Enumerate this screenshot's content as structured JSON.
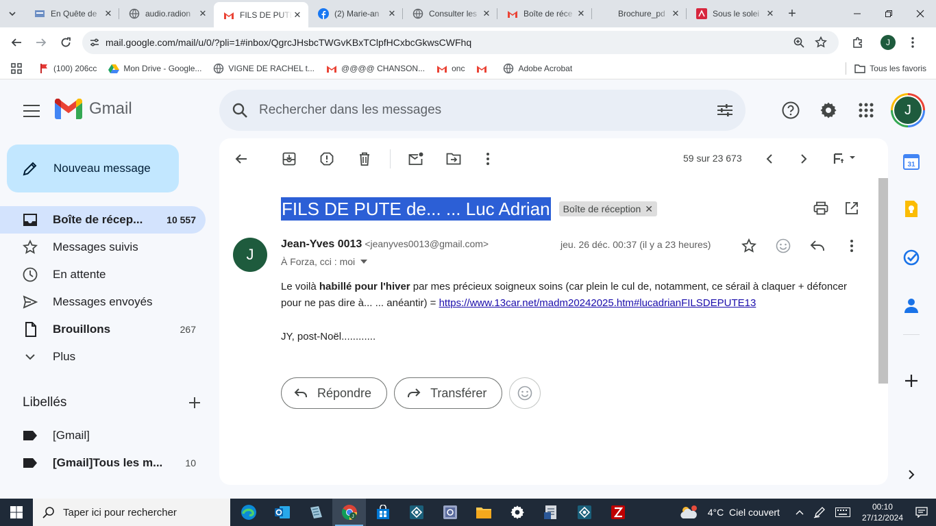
{
  "browser": {
    "tabs": [
      {
        "title": "En Quête de",
        "favicon": "page-icon",
        "active": false
      },
      {
        "title": "audio.radion",
        "favicon": "globe-icon",
        "active": false
      },
      {
        "title": "FILS DE PUTE",
        "favicon": "gmail-icon",
        "active": true
      },
      {
        "title": "(2) Marie-an",
        "favicon": "facebook-icon",
        "active": false
      },
      {
        "title": "Consulter les",
        "favicon": "globe-icon",
        "active": false
      },
      {
        "title": "Boîte de réce",
        "favicon": "gmail-icon",
        "active": false
      },
      {
        "title": "Brochure_pd",
        "favicon": "blank-icon",
        "active": false
      },
      {
        "title": "Sous le solei",
        "favicon": "pdf-icon",
        "active": false
      }
    ],
    "url": "mail.google.com/mail/u/0/?pli=1#inbox/QgrcJHsbcTWGvKBxTClpfHCxbcGkwsCWFhq",
    "profile_initial": "J",
    "bookmarks": [
      {
        "label": "(100) 206cc",
        "icon": "flag-icon"
      },
      {
        "label": "Mon Drive - Google...",
        "icon": "drive-icon"
      },
      {
        "label": "VIGNE DE RACHEL t...",
        "icon": "globe-icon"
      },
      {
        "label": "@@@@ CHANSON...",
        "icon": "gmail-icon"
      },
      {
        "label": "onc",
        "icon": "gmail-icon"
      },
      {
        "label": "",
        "icon": "gmail-icon"
      },
      {
        "label": "Adobe Acrobat",
        "icon": "globe-icon"
      }
    ],
    "all_bookmarks_label": "Tous les favoris"
  },
  "gmail": {
    "logo_text": "Gmail",
    "search_placeholder": "Rechercher dans les messages",
    "avatar_initial": "J",
    "compose_label": "Nouveau message",
    "nav": [
      {
        "label": "Boîte de récep...",
        "count": "10 557",
        "icon": "inbox-icon",
        "active": true,
        "bold": true
      },
      {
        "label": "Messages suivis",
        "count": "",
        "icon": "star-icon",
        "active": false,
        "bold": false
      },
      {
        "label": "En attente",
        "count": "",
        "icon": "clock-icon",
        "active": false,
        "bold": false
      },
      {
        "label": "Messages envoyés",
        "count": "",
        "icon": "send-icon",
        "active": false,
        "bold": false
      },
      {
        "label": "Brouillons",
        "count": "267",
        "icon": "draft-icon",
        "active": false,
        "bold": true
      },
      {
        "label": "Plus",
        "count": "",
        "icon": "chevron-down-icon",
        "active": false,
        "bold": false
      }
    ],
    "labels_heading": "Libellés",
    "labels": [
      {
        "label": "[Gmail]",
        "count": "",
        "bold": false
      },
      {
        "label": "[Gmail]Tous les m...",
        "count": "10",
        "bold": true
      }
    ],
    "message_counter": "59 sur 23 673",
    "subject": "FILS DE PUTE de... ... Luc Adrian",
    "subject_chip": "Boîte de réception",
    "sender_initial": "J",
    "sender_name": "Jean-Yves 0013",
    "sender_email": "<jeanyves0013@gmail.com>",
    "recipients": "À Forza, cci : moi",
    "date": "jeu. 26 déc. 00:37 (il y a 23 heures)",
    "body": {
      "p1_a": "Le voilà ",
      "p1_bold": "habillé pour l'hiver",
      "p1_b": " par mes précieux soigneux soins (car plein le cul de, notamment,  ce sérail à claquer + défoncer pour ne pas dire à... ... anéantir) = ",
      "link": "https://www.13car.net/madm20242025.htm#lucadrianFILSDEPUTE13",
      "signature": "JY, post-Noël............"
    },
    "reply_label": "Répondre",
    "forward_label": "Transférer"
  },
  "taskbar": {
    "search_placeholder": "Taper ici pour rechercher",
    "weather": "4°C  Ciel couvert",
    "time": "00:10",
    "date": "27/12/2024"
  },
  "colors": {
    "accent": "#0b57d0",
    "compose_bg": "#c2e7ff",
    "active_nav_bg": "#d3e3fd",
    "selection": "#2c5fd6",
    "avatar_green": "#1e5b3d"
  }
}
